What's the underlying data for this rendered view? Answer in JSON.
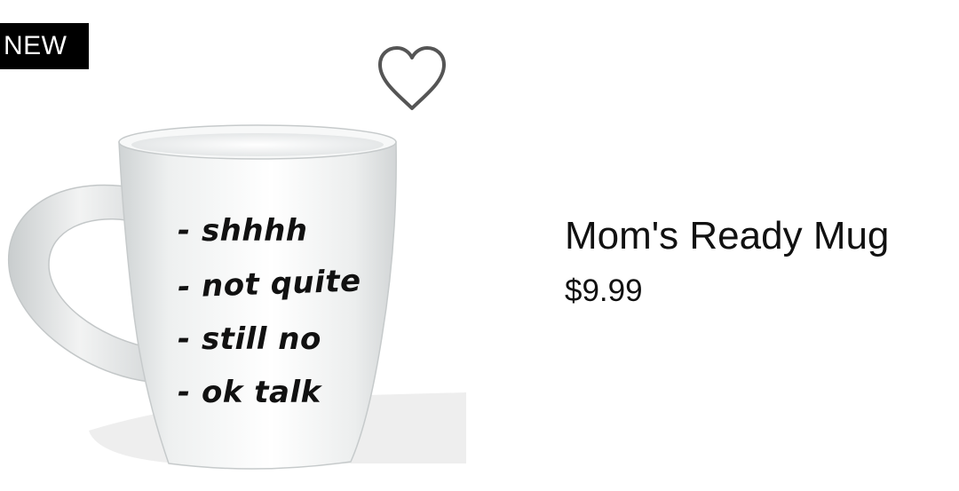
{
  "badge": {
    "label": "NEW"
  },
  "product": {
    "name": "Mom's Ready Mug",
    "price": "$9.99",
    "mug_print_lines": [
      "- shhhh",
      "- not quite",
      "- still no",
      "- ok talk"
    ]
  },
  "icons": {
    "favorite": "heart-outline-icon"
  },
  "colors": {
    "badge_bg": "#000000",
    "badge_text": "#ffffff",
    "text": "#111111",
    "heart_stroke": "#555555"
  }
}
